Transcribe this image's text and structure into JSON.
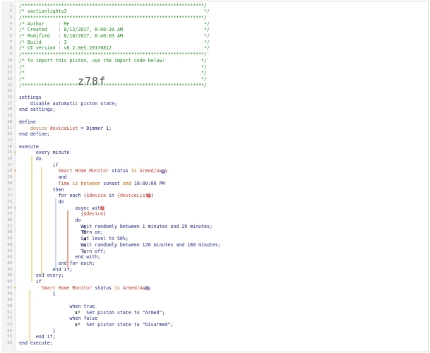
{
  "lines": [
    {
      "n": "1",
      "parts": [
        [
          "g",
          "/*****************************************************************/"
        ]
      ]
    },
    {
      "n": "2",
      "parts": [
        [
          "g",
          "/* vactionlights3                                                 */"
        ]
      ]
    },
    {
      "n": "3",
      "parts": [
        [
          "g",
          "/*****************************************************************/"
        ]
      ]
    },
    {
      "n": "4",
      "parts": [
        [
          "g",
          "/* Author     : Me                                                */"
        ]
      ]
    },
    {
      "n": "5",
      "parts": [
        [
          "g",
          "/* Created    : 8/12/2017, 8:00:20 AM                             */"
        ]
      ]
    },
    {
      "n": "6",
      "parts": [
        [
          "g",
          "/* Modified   : 8/18/2017, 6:40:03 AM                             */"
        ]
      ]
    },
    {
      "n": "7",
      "parts": [
        [
          "g",
          "/* Build      : 3                                                 */"
        ]
      ]
    },
    {
      "n": "8",
      "parts": [
        [
          "g",
          "/* UI version : v0.2.0e5.20170812                                 */"
        ]
      ]
    },
    {
      "n": "9",
      "parts": [
        [
          "g",
          "/*****************************************************************/"
        ]
      ]
    },
    {
      "n": "10",
      "parts": [
        [
          "g",
          "/* To import this piston, use the import code below:             */"
        ]
      ]
    },
    {
      "n": "11",
      "parts": [
        [
          "g",
          "/*                                                               */"
        ]
      ]
    },
    {
      "n": "12",
      "parts": [
        [
          "g",
          "/*                                                               */"
        ]
      ]
    },
    {
      "n": "13",
      "parts": [
        [
          "g",
          "/*                                                               */"
        ]
      ]
    },
    {
      "n": "14",
      "parts": [
        [
          "g",
          "/*****************************************************************/"
        ]
      ]
    },
    {
      "n": "15",
      "parts": []
    },
    {
      "n": "16",
      "parts": [
        [
          "kw",
          "settings"
        ]
      ]
    },
    {
      "n": "17",
      "parts": [
        [
          "kw",
          "    disable automatic piston state;"
        ]
      ]
    },
    {
      "n": "18",
      "parts": [
        [
          "kw",
          "end settings;"
        ]
      ]
    },
    {
      "n": "19",
      "parts": []
    },
    {
      "n": "20",
      "parts": [
        [
          "kw",
          "define"
        ]
      ]
    },
    {
      "n": "21",
      "parts": [
        [
          "kw",
          "    "
        ],
        [
          "dim",
          "device "
        ],
        [
          "vr",
          "deviceList"
        ],
        [
          "kw",
          " = "
        ],
        [
          "val",
          "Dimmer 1"
        ],
        [
          "kw",
          ";"
        ]
      ]
    },
    {
      "n": "22",
      "parts": [
        [
          "kw",
          "end define;"
        ]
      ]
    },
    {
      "n": "23",
      "parts": []
    },
    {
      "n": "24",
      "parts": [
        [
          "kw",
          "execute"
        ]
      ]
    },
    {
      "n": "25",
      "parts": [
        [
          "kw",
          "      every "
        ],
        [
          "val",
          "minute"
        ]
      ]
    },
    {
      "n": "26",
      "parts": [
        [
          "kw",
          "      do"
        ]
      ]
    },
    {
      "n": "27",
      "parts": [
        [
          "kw",
          "            if"
        ]
      ]
    },
    {
      "n": "28",
      "parts": [
        [
          "kw",
          "              "
        ],
        [
          "dev",
          "Smart Home Monitor"
        ],
        [
          "kw",
          " status "
        ],
        [
          "op",
          "is"
        ],
        [
          "kw",
          " "
        ],
        [
          "dev",
          "Armed/Away"
        ]
      ]
    },
    {
      "n": "29",
      "parts": [
        [
          "kw",
          "              and"
        ]
      ]
    },
    {
      "n": "30",
      "parts": [
        [
          "kw",
          "              "
        ],
        [
          "dev",
          "Time"
        ],
        [
          "kw",
          " "
        ],
        [
          "op",
          "is between"
        ],
        [
          "kw",
          " "
        ],
        [
          "val",
          "sunset"
        ],
        [
          "kw",
          " "
        ],
        [
          "op",
          "and"
        ],
        [
          "kw",
          " "
        ],
        [
          "val",
          "10:00:00 PM"
        ]
      ]
    },
    {
      "n": "31",
      "parts": [
        [
          "kw",
          "            then"
        ]
      ]
    },
    {
      "n": "32",
      "parts": [
        [
          "kw",
          "              for each ("
        ],
        [
          "vr",
          "$device"
        ],
        [
          "kw",
          " in "
        ],
        [
          "vr",
          "{deviceList}"
        ],
        [
          "kw",
          ")"
        ]
      ]
    },
    {
      "n": "33",
      "parts": [
        [
          "kw",
          "              do"
        ]
      ]
    },
    {
      "n": "34",
      "parts": [
        [
          "kw",
          "                    async with"
        ]
      ]
    },
    {
      "n": "35",
      "parts": [
        [
          "kw",
          "                      "
        ],
        [
          "vr",
          "{$device}"
        ]
      ]
    },
    {
      "n": "36",
      "parts": [
        [
          "kw",
          "                    do"
        ]
      ]
    },
    {
      "n": "37",
      "parts": [
        [
          "kw",
          "                      Wait randomly between "
        ],
        [
          "val",
          "1"
        ],
        [
          "kw",
          " minutes and "
        ],
        [
          "val",
          "29"
        ],
        [
          "kw",
          " minutes;"
        ]
      ]
    },
    {
      "n": "38",
      "parts": [
        [
          "kw",
          "                      Turn on;"
        ]
      ]
    },
    {
      "n": "39",
      "parts": [
        [
          "kw",
          "                      Set level to "
        ],
        [
          "val",
          "50"
        ],
        [
          "kw",
          "%;"
        ]
      ]
    },
    {
      "n": "40",
      "parts": [
        [
          "kw",
          "                      Wait randomly between "
        ],
        [
          "val",
          "120"
        ],
        [
          "kw",
          " minutes and "
        ],
        [
          "val",
          "180"
        ],
        [
          "kw",
          " minutes;"
        ]
      ]
    },
    {
      "n": "41",
      "parts": [
        [
          "kw",
          "                      Turn off;"
        ]
      ]
    },
    {
      "n": "42",
      "parts": [
        [
          "kw",
          "                    end with;"
        ]
      ]
    },
    {
      "n": "43",
      "parts": [
        [
          "kw",
          "              end for each;"
        ]
      ]
    },
    {
      "n": "44",
      "parts": [
        [
          "kw",
          "            end if;"
        ]
      ]
    },
    {
      "n": "45",
      "parts": [
        [
          "kw",
          "      end every;"
        ]
      ]
    },
    {
      "n": "46",
      "parts": [
        [
          "kw",
          "      if"
        ]
      ]
    },
    {
      "n": "47",
      "parts": [
        [
          "kw",
          "        "
        ],
        [
          "dev",
          "Smart Home Monitor"
        ],
        [
          "kw",
          " status "
        ],
        [
          "op",
          "is"
        ],
        [
          "kw",
          " "
        ],
        [
          "dev",
          "Armed/Away"
        ]
      ]
    },
    {
      "n": "48",
      "parts": [
        [
          "kw",
          "            {"
        ]
      ]
    },
    {
      "n": "49",
      "parts": []
    },
    {
      "n": "50",
      "parts": [
        [
          "kw",
          "                  when "
        ],
        [
          "val",
          "true"
        ]
      ]
    },
    {
      "n": "51",
      "parts": [
        [
          "kw",
          "                        Set piston state to \"Armed\";"
        ]
      ]
    },
    {
      "n": "52",
      "parts": [
        [
          "kw",
          "                  when "
        ],
        [
          "val",
          "false"
        ]
      ]
    },
    {
      "n": "53",
      "parts": [
        [
          "kw",
          "                        Set piston state to \"Disarmed\";"
        ]
      ]
    },
    {
      "n": "54",
      "parts": [
        [
          "kw",
          "            }"
        ]
      ]
    },
    {
      "n": "55",
      "parts": [
        [
          "kw",
          "      end if;"
        ]
      ]
    },
    {
      "n": "56",
      "parts": [
        [
          "kw",
          "end execute;"
        ]
      ]
    }
  ],
  "import_code": "z78f",
  "icons": {
    "wait": "clock-icon",
    "turn_on": "power-icon",
    "level": "signal-icon",
    "turn_off": "power-off-icon",
    "set_state": "variable-icon",
    "info_badge": "info-badge-icon",
    "error_badge": "error-badge-icon"
  },
  "colors": {
    "comment": "#1a8a1a",
    "keyword": "#1a237e",
    "device": "#c0392b",
    "operator": "#c25f00"
  }
}
